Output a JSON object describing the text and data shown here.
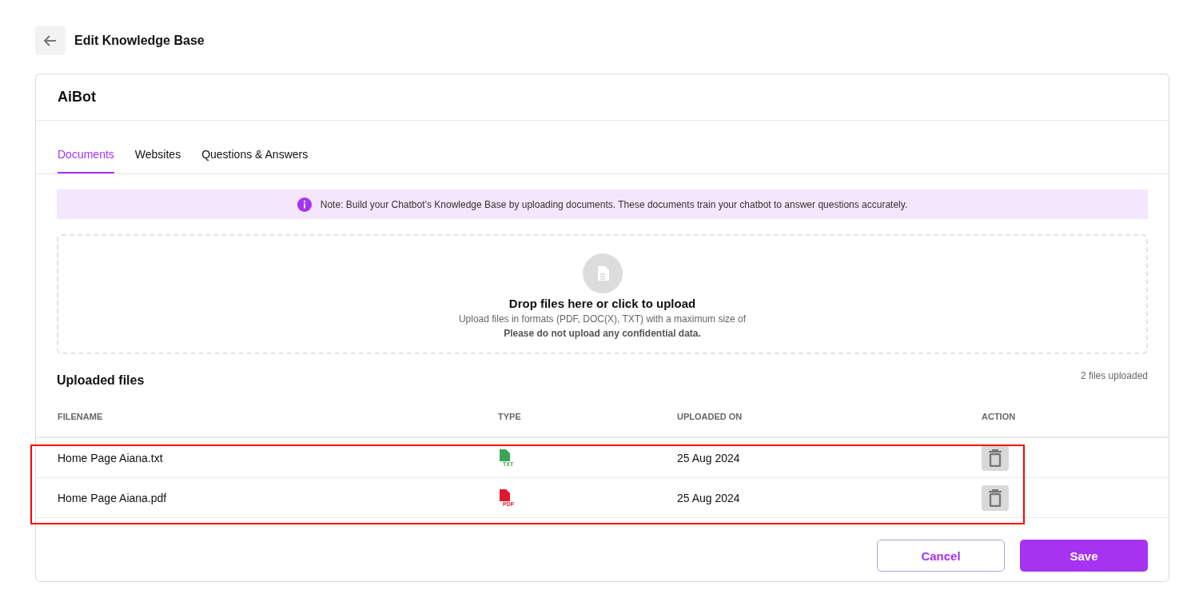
{
  "header": {
    "title": "Edit Knowledge Base"
  },
  "card": {
    "title": "AiBot"
  },
  "tabs": [
    {
      "label": "Documents",
      "selected": true
    },
    {
      "label": "Websites",
      "selected": false
    },
    {
      "label": "Questions & Answers",
      "selected": false
    }
  ],
  "note": "Note: Build your Chatbot’s Knowledge Base by uploading documents. These documents train your chatbot to answer questions accurately.",
  "upload": {
    "title": "Drop files here or click to upload",
    "hint": "Upload files in formats (PDF, DOC(X), TXT) with a maximum size of",
    "warning": "Please do not upload any confidential data."
  },
  "uploaded": {
    "title": "Uploaded files",
    "count": "2 files uploaded"
  },
  "table": {
    "columns": [
      "FILENAME",
      "TYPE",
      "UPLOADED ON",
      "ACTION"
    ],
    "highlighted": true,
    "rows": [
      {
        "filename": "Home Page Aiana.txt",
        "kind": "txt",
        "type_label": "TXT",
        "date": "25 Aug 2024"
      },
      {
        "filename": "Home Page Aiana.pdf",
        "kind": "pdf",
        "type_label": "PDF",
        "date": "25 Aug 2024"
      }
    ]
  },
  "buttons": {
    "cancel": "Cancel",
    "save": "Save"
  }
}
